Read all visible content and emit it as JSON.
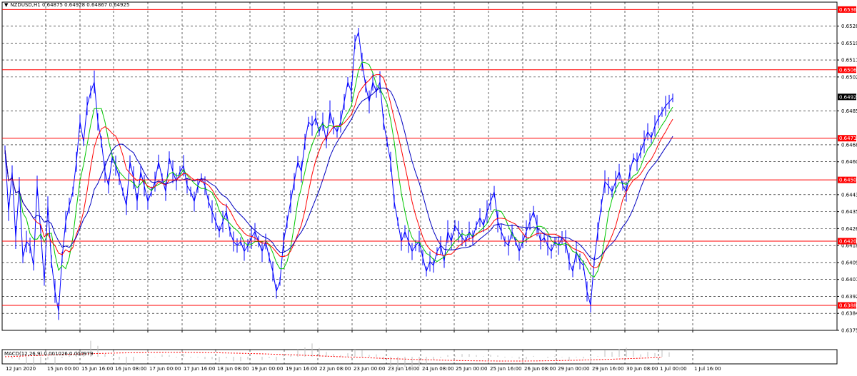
{
  "header": {
    "arrow": "▼",
    "symbol": "NZDUSD,H1",
    "ohlc": "0.64875 0.64928 0.64867 0.64925"
  },
  "macd_header": {
    "label": "MACD(12,26,9) 0.001026 0.000979"
  },
  "colors": {
    "price": "#0000ff",
    "ma_fast": "#00c800",
    "ma_mid": "#ff0000",
    "ma_slow": "#0000c0",
    "level_line": "#ff0000",
    "level_label_bg": "#ff0000",
    "current_price_bg": "#000000",
    "grid": "#000000",
    "macd_hist": "#bfbfbf",
    "macd_signal": "#ff0000"
  },
  "chart_data": {
    "type": "line",
    "title": "NZDUSD,H1",
    "ylim": [
      0.63755,
      0.654
    ],
    "price_axis_ticks": [
      "0.65280",
      "0.65195",
      "0.65110",
      "0.65025",
      "0.64855",
      "0.64685",
      "0.64600",
      "0.64435",
      "0.64350",
      "0.64265",
      "0.64180",
      "0.64095",
      "0.64010",
      "0.63925",
      "0.63840",
      "0.63755"
    ],
    "time_axis_labels": [
      "12 Jun 2020",
      "15 Jun 00:00",
      "15 Jun 16:00",
      "16 Jun 08:00",
      "17 Jun 00:00",
      "17 Jun 16:00",
      "18 Jun 08:00",
      "19 Jun 00:00",
      "19 Jun 16:00",
      "22 Jun 08:00",
      "23 Jun 00:00",
      "23 Jun 16:00",
      "24 Jun 08:00",
      "25 Jun 00:00",
      "25 Jun 16:00",
      "26 Jun 08:00",
      "29 Jun 00:00",
      "29 Jun 16:00",
      "30 Jun 08:00",
      "1 Jul 00:00",
      "1 Jul 16:00"
    ],
    "levels": [
      {
        "value": 0.65363,
        "label": "0.65363"
      },
      {
        "value": 0.65061,
        "label": "0.65061"
      },
      {
        "value": 0.64718,
        "label": "0.64718"
      },
      {
        "value": 0.64509,
        "label": "0.64509"
      },
      {
        "value": 0.64202,
        "label": "0.64202"
      },
      {
        "value": 0.6388,
        "label": "0.63880"
      }
    ],
    "current_price": {
      "value": 0.64925,
      "label": "0.64925"
    },
    "price_path": [
      [
        0,
        0.6466
      ],
      [
        5,
        0.6435
      ],
      [
        10,
        0.6455
      ],
      [
        15,
        0.6422
      ],
      [
        20,
        0.6448
      ],
      [
        25,
        0.6412
      ],
      [
        30,
        0.642
      ],
      [
        35,
        0.6418
      ],
      [
        40,
        0.6408
      ],
      [
        45,
        0.6448
      ],
      [
        50,
        0.6425
      ],
      [
        55,
        0.64
      ],
      [
        60,
        0.6438
      ],
      [
        65,
        0.641
      ],
      [
        70,
        0.6395
      ],
      [
        75,
        0.6385
      ],
      [
        80,
        0.6412
      ],
      [
        85,
        0.643
      ],
      [
        90,
        0.6438
      ],
      [
        95,
        0.6445
      ],
      [
        100,
        0.646
      ],
      [
        105,
        0.648
      ],
      [
        110,
        0.647
      ],
      [
        115,
        0.6488
      ],
      [
        120,
        0.6495
      ],
      [
        125,
        0.65
      ],
      [
        130,
        0.648
      ],
      [
        135,
        0.647
      ],
      [
        140,
        0.6455
      ],
      [
        145,
        0.6448
      ],
      [
        150,
        0.6462
      ],
      [
        155,
        0.6458
      ],
      [
        160,
        0.6452
      ],
      [
        165,
        0.6445
      ],
      [
        170,
        0.6438
      ],
      [
        175,
        0.646
      ],
      [
        180,
        0.6452
      ],
      [
        185,
        0.644
      ],
      [
        190,
        0.6455
      ],
      [
        195,
        0.6448
      ],
      [
        200,
        0.644
      ],
      [
        205,
        0.6445
      ],
      [
        210,
        0.645
      ],
      [
        215,
        0.646
      ],
      [
        220,
        0.6452
      ],
      [
        225,
        0.6445
      ],
      [
        230,
        0.6462
      ],
      [
        235,
        0.6455
      ],
      [
        240,
        0.645
      ],
      [
        245,
        0.6455
      ],
      [
        250,
        0.6458
      ],
      [
        255,
        0.6448
      ],
      [
        260,
        0.6445
      ],
      [
        265,
        0.644
      ],
      [
        270,
        0.6448
      ],
      [
        275,
        0.6452
      ],
      [
        280,
        0.6448
      ],
      [
        285,
        0.644
      ],
      [
        290,
        0.6435
      ],
      [
        295,
        0.643
      ],
      [
        300,
        0.6425
      ],
      [
        305,
        0.643
      ],
      [
        310,
        0.6435
      ],
      [
        315,
        0.6425
      ],
      [
        320,
        0.642
      ],
      [
        325,
        0.6418
      ],
      [
        330,
        0.642
      ],
      [
        335,
        0.6415
      ],
      [
        340,
        0.6418
      ],
      [
        345,
        0.6422
      ],
      [
        350,
        0.6425
      ],
      [
        355,
        0.642
      ],
      [
        360,
        0.6415
      ],
      [
        365,
        0.642
      ],
      [
        370,
        0.6412
      ],
      [
        375,
        0.6405
      ],
      [
        380,
        0.6395
      ],
      [
        385,
        0.64
      ],
      [
        390,
        0.642
      ],
      [
        395,
        0.643
      ],
      [
        400,
        0.644
      ],
      [
        405,
        0.645
      ],
      [
        410,
        0.646
      ],
      [
        415,
        0.6455
      ],
      [
        420,
        0.647
      ],
      [
        425,
        0.648
      ],
      [
        430,
        0.6478
      ],
      [
        435,
        0.6482
      ],
      [
        440,
        0.6475
      ],
      [
        445,
        0.648
      ],
      [
        450,
        0.647
      ],
      [
        455,
        0.6485
      ],
      [
        460,
        0.6478
      ],
      [
        465,
        0.6475
      ],
      [
        470,
        0.648
      ],
      [
        475,
        0.649
      ],
      [
        480,
        0.65
      ],
      [
        485,
        0.6495
      ],
      [
        490,
        0.652
      ],
      [
        495,
        0.6525
      ],
      [
        500,
        0.651
      ],
      [
        505,
        0.6498
      ],
      [
        510,
        0.649
      ],
      [
        515,
        0.65
      ],
      [
        520,
        0.6495
      ],
      [
        525,
        0.65
      ],
      [
        530,
        0.648
      ],
      [
        535,
        0.647
      ],
      [
        540,
        0.646
      ],
      [
        545,
        0.644
      ],
      [
        550,
        0.643
      ],
      [
        555,
        0.642
      ],
      [
        560,
        0.6425
      ],
      [
        565,
        0.642
      ],
      [
        570,
        0.6415
      ],
      [
        575,
        0.6418
      ],
      [
        580,
        0.642
      ],
      [
        585,
        0.6412
      ],
      [
        590,
        0.6405
      ],
      [
        595,
        0.641
      ],
      [
        600,
        0.6408
      ],
      [
        605,
        0.6415
      ],
      [
        610,
        0.6418
      ],
      [
        615,
        0.641
      ],
      [
        620,
        0.6425
      ],
      [
        625,
        0.642
      ],
      [
        630,
        0.6428
      ],
      [
        635,
        0.6425
      ],
      [
        640,
        0.6422
      ],
      [
        645,
        0.642
      ],
      [
        650,
        0.6425
      ],
      [
        655,
        0.6422
      ],
      [
        660,
        0.6428
      ],
      [
        665,
        0.6432
      ],
      [
        670,
        0.6428
      ],
      [
        675,
        0.6435
      ],
      [
        680,
        0.644
      ],
      [
        685,
        0.6445
      ],
      [
        690,
        0.643
      ],
      [
        695,
        0.6425
      ],
      [
        700,
        0.642
      ],
      [
        705,
        0.6418
      ],
      [
        710,
        0.6425
      ],
      [
        715,
        0.642
      ],
      [
        720,
        0.6415
      ],
      [
        725,
        0.642
      ],
      [
        730,
        0.6425
      ],
      [
        735,
        0.643
      ],
      [
        740,
        0.6435
      ],
      [
        745,
        0.6428
      ],
      [
        750,
        0.642
      ],
      [
        755,
        0.6422
      ],
      [
        760,
        0.6418
      ],
      [
        765,
        0.6415
      ],
      [
        770,
        0.642
      ],
      [
        775,
        0.6418
      ],
      [
        780,
        0.6422
      ],
      [
        785,
        0.642
      ],
      [
        790,
        0.641
      ],
      [
        795,
        0.6405
      ],
      [
        800,
        0.6415
      ],
      [
        805,
        0.641
      ],
      [
        810,
        0.6408
      ],
      [
        815,
        0.6395
      ],
      [
        820,
        0.6388
      ],
      [
        825,
        0.641
      ],
      [
        830,
        0.6425
      ],
      [
        835,
        0.6438
      ],
      [
        840,
        0.645
      ],
      [
        845,
        0.6448
      ],
      [
        850,
        0.6445
      ],
      [
        855,
        0.645
      ],
      [
        860,
        0.6455
      ],
      [
        865,
        0.6448
      ],
      [
        870,
        0.6445
      ],
      [
        875,
        0.6455
      ],
      [
        880,
        0.6462
      ],
      [
        885,
        0.646
      ],
      [
        890,
        0.6465
      ],
      [
        895,
        0.647
      ],
      [
        900,
        0.6475
      ],
      [
        905,
        0.6472
      ],
      [
        910,
        0.6478
      ],
      [
        915,
        0.6482
      ],
      [
        920,
        0.6485
      ],
      [
        925,
        0.6488
      ],
      [
        930,
        0.649
      ],
      [
        935,
        0.6492
      ]
    ]
  }
}
